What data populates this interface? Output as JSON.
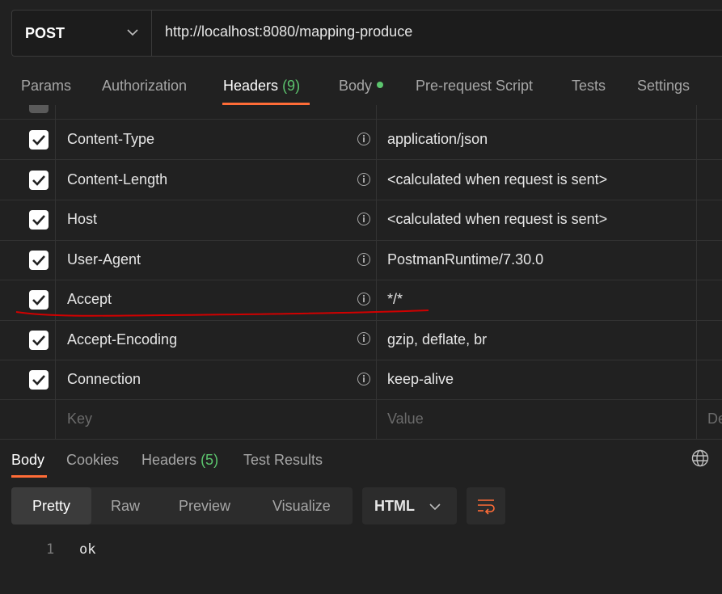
{
  "request": {
    "method": "POST",
    "url": "http://localhost:8080/mapping-produce"
  },
  "request_tabs": [
    {
      "label": "Params"
    },
    {
      "label": "Authorization"
    },
    {
      "label": "Headers",
      "count": "(9)"
    },
    {
      "label": "Body"
    },
    {
      "label": "Pre-request Script"
    },
    {
      "label": "Tests"
    },
    {
      "label": "Settings"
    }
  ],
  "active_request_tab": "Headers",
  "headers": [
    {
      "key": "Content-Type",
      "value": "application/json",
      "enabled": true
    },
    {
      "key": "Content-Length",
      "value": "<calculated when request is sent>",
      "enabled": true
    },
    {
      "key": "Host",
      "value": "<calculated when request is sent>",
      "enabled": true
    },
    {
      "key": "User-Agent",
      "value": "PostmanRuntime/7.30.0",
      "enabled": true
    },
    {
      "key": "Accept",
      "value": "*/*",
      "enabled": true
    },
    {
      "key": "Accept-Encoding",
      "value": "gzip, deflate, br",
      "enabled": true
    },
    {
      "key": "Connection",
      "value": "keep-alive",
      "enabled": true
    }
  ],
  "new_row": {
    "key_placeholder": "Key",
    "value_placeholder": "Value",
    "desc_placeholder": "De"
  },
  "response_tabs": [
    {
      "label": "Body"
    },
    {
      "label": "Cookies"
    },
    {
      "label": "Headers",
      "count": "(5)"
    },
    {
      "label": "Test Results"
    }
  ],
  "active_response_tab": "Body",
  "view_modes": [
    "Pretty",
    "Raw",
    "Preview",
    "Visualize"
  ],
  "active_view_mode": "Pretty",
  "format": "HTML",
  "response_body": {
    "line_number": "1",
    "text": "ok"
  },
  "colors": {
    "accent": "#ff6c37",
    "count_green": "#5cc56e",
    "annotation_red": "#d10000",
    "background": "#212121"
  },
  "icons": [
    "chevron-down-icon",
    "info-icon",
    "checkbox-checked-icon",
    "globe-icon",
    "wrap-lines-icon"
  ]
}
